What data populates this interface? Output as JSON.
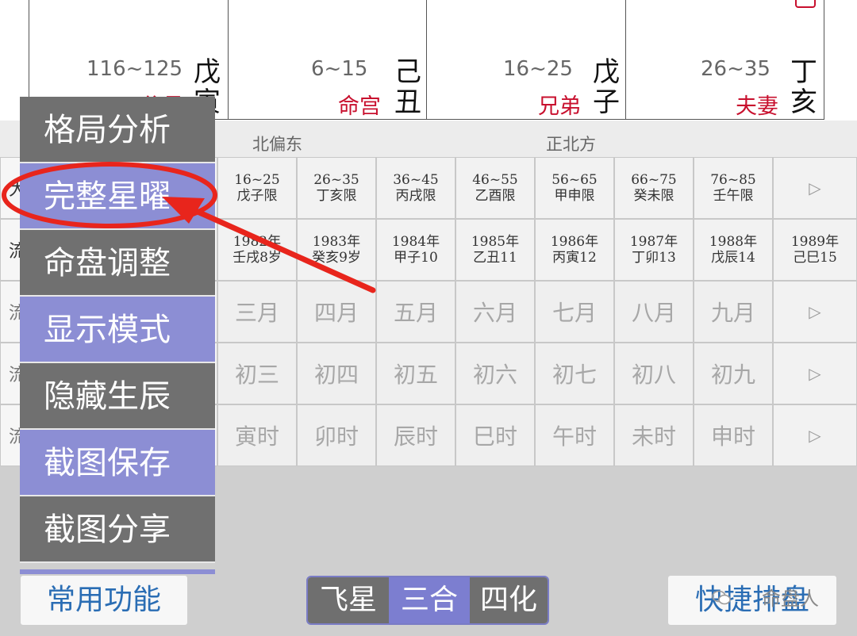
{
  "palaces": [
    {
      "range": "116~125",
      "name": "父母",
      "gz_top": "戊",
      "gz_bottom": "寅"
    },
    {
      "range": "6~15",
      "name": "命宫",
      "gz_top": "己",
      "gz_bottom": "丑"
    },
    {
      "range": "16~25",
      "name": "兄弟",
      "gz_top": "戊",
      "gz_bottom": "子"
    },
    {
      "range": "26~35",
      "name": "夫妻",
      "gz_top": "丁",
      "gz_bottom": "亥"
    }
  ],
  "directions": {
    "left": "北偏东",
    "right": "正北方"
  },
  "row_labels": [
    "大",
    "流",
    "流",
    "流",
    "流"
  ],
  "decade_row": [
    {
      "l1": "16~25",
      "l2": "戊子限"
    },
    {
      "l1": "26~35",
      "l2": "丁亥限"
    },
    {
      "l1": "36~45",
      "l2": "丙戌限"
    },
    {
      "l1": "46~55",
      "l2": "乙酉限"
    },
    {
      "l1": "56~65",
      "l2": "甲申限"
    },
    {
      "l1": "66~75",
      "l2": "癸未限"
    },
    {
      "l1": "76~85",
      "l2": "壬午限"
    }
  ],
  "year_row": [
    {
      "l1": "1982年",
      "l2": "壬戌8岁"
    },
    {
      "l1": "1983年",
      "l2": "癸亥9岁"
    },
    {
      "l1": "1984年",
      "l2": "甲子10"
    },
    {
      "l1": "1985年",
      "l2": "乙丑11"
    },
    {
      "l1": "1986年",
      "l2": "丙寅12"
    },
    {
      "l1": "1987年",
      "l2": "丁卯13"
    },
    {
      "l1": "1988年",
      "l2": "戊辰14"
    },
    {
      "l1": "1989年",
      "l2": "己巳15"
    }
  ],
  "month_row": [
    "三月",
    "四月",
    "五月",
    "六月",
    "七月",
    "八月",
    "九月"
  ],
  "day_row": [
    "初三",
    "初四",
    "初五",
    "初六",
    "初七",
    "初八",
    "初九"
  ],
  "hour_row": [
    "寅时",
    "卯时",
    "辰时",
    "巳时",
    "午时",
    "未时",
    "申时"
  ],
  "next_arrow": "▷",
  "menu": {
    "items": [
      "格局分析",
      "完整星曜",
      "命盘调整",
      "显示模式",
      "隐藏生辰",
      "截图保存",
      "截图分享"
    ]
  },
  "bottom": {
    "common": "常用功能",
    "tabs": [
      "飞星",
      "三合",
      "四化"
    ],
    "active_tab": "三合",
    "quick": "快捷排盘",
    "watermark": "命盘人"
  },
  "colors": {
    "palace_name": "#c8102e",
    "menu_dark": "#707070",
    "menu_blue": "#8c8ed4",
    "link_blue": "#2a6db4",
    "annotation_red": "#e8251c"
  }
}
